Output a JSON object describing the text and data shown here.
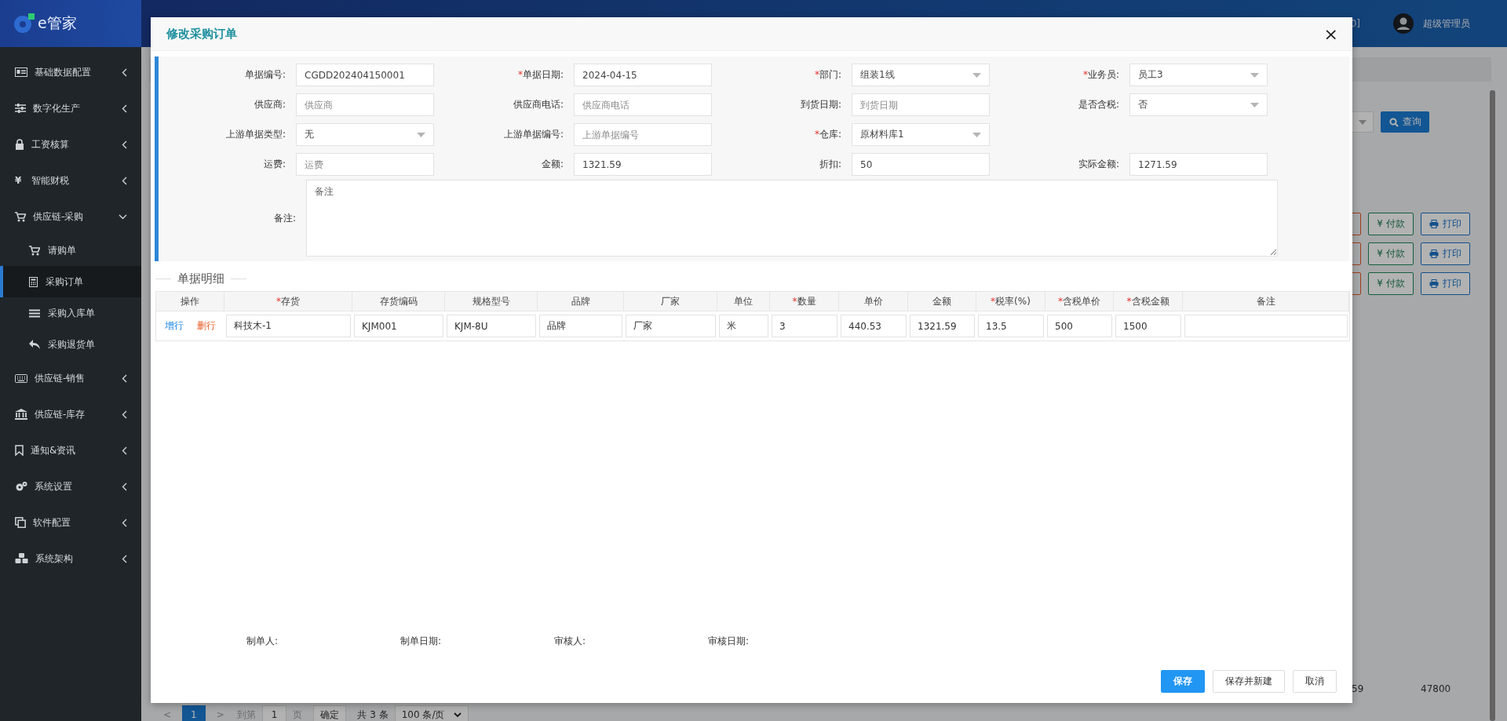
{
  "app": {
    "logo_text": "e管家"
  },
  "sidebar": {
    "items": [
      {
        "label": "基础数据配置",
        "expanded": false
      },
      {
        "label": "数字化生产",
        "expanded": false
      },
      {
        "label": "工资核算",
        "expanded": false
      },
      {
        "label": "智能财税",
        "expanded": false,
        "icon_text": "¥"
      },
      {
        "label": "供应链-采购",
        "expanded": true,
        "children": [
          {
            "label": "请购单",
            "selected": false
          },
          {
            "label": "采购订单",
            "selected": true
          },
          {
            "label": "采购入库单",
            "selected": false
          },
          {
            "label": "采购退货单",
            "selected": false
          }
        ]
      },
      {
        "label": "供应链-销售",
        "expanded": false
      },
      {
        "label": "供应链-库存",
        "expanded": false
      },
      {
        "label": "通知&资讯",
        "expanded": false
      },
      {
        "label": "系统设置",
        "expanded": false
      },
      {
        "label": "软件配置",
        "expanded": false
      },
      {
        "label": "系统架构",
        "expanded": false
      }
    ]
  },
  "header": {
    "partial_text": "0]",
    "user": "超级管理员"
  },
  "background": {
    "search_button": "查询",
    "row_actions": [
      {
        "pay_icon": "¥",
        "pay": "付款",
        "print": "打印"
      },
      {
        "pay_icon": "¥",
        "pay": "付款",
        "print": "打印"
      },
      {
        "pay_icon": "¥",
        "pay": "付款",
        "print": "打印"
      }
    ],
    "row_values": [
      "59",
      "47800"
    ],
    "pagination": {
      "prev": "<",
      "page": "1",
      "next": ">",
      "goto": "到第",
      "page_input": "1",
      "page_unit": "页",
      "confirm": "确定",
      "total": "共 3 条",
      "page_size": "100 条/页"
    }
  },
  "dialog": {
    "title": "修改采购订单",
    "close": "×",
    "required_mark": "*",
    "fields": [
      {
        "label": "单据编号:",
        "required": false,
        "kind": "text",
        "value": "CGDD202404150001"
      },
      {
        "label": "单据日期:",
        "required": true,
        "kind": "text",
        "value": "2024-04-15"
      },
      {
        "label": "部门:",
        "required": true,
        "kind": "select",
        "value": "组装1线"
      },
      {
        "label": "业务员:",
        "required": true,
        "kind": "select",
        "value": "员工3"
      },
      {
        "label": "供应商:",
        "required": false,
        "kind": "text",
        "placeholder": "供应商"
      },
      {
        "label": "供应商电话:",
        "required": false,
        "kind": "text",
        "placeholder": "供应商电话"
      },
      {
        "label": "到货日期:",
        "required": false,
        "kind": "text",
        "placeholder": "到货日期"
      },
      {
        "label": "是否含税:",
        "required": false,
        "kind": "select",
        "value": "否"
      },
      {
        "label": "上游单据类型:",
        "required": false,
        "kind": "select",
        "value": "无"
      },
      {
        "label": "上游单据编号:",
        "required": false,
        "kind": "text",
        "placeholder": "上游单据编号"
      },
      {
        "label": "仓库:",
        "required": true,
        "kind": "select",
        "value": "原材料库1"
      },
      {
        "kind": "empty"
      },
      {
        "label": "运费:",
        "required": false,
        "kind": "text",
        "placeholder": "运费"
      },
      {
        "label": "金额:",
        "required": false,
        "kind": "text",
        "value": "1321.59"
      },
      {
        "label": "折扣:",
        "required": false,
        "kind": "text",
        "value": "50"
      },
      {
        "label": "实际金额:",
        "required": false,
        "kind": "text",
        "value": "1271.59"
      }
    ],
    "remark": {
      "label": "备注:",
      "placeholder": "备注"
    },
    "detail": {
      "title": "单据明细",
      "required_mark": "*",
      "action_column": {
        "label": "操作"
      },
      "columns": [
        {
          "label": "存货",
          "required": true
        },
        {
          "label": "存货编码",
          "required": false
        },
        {
          "label": "规格型号",
          "required": false
        },
        {
          "label": "品牌",
          "required": false
        },
        {
          "label": "厂家",
          "required": false
        },
        {
          "label": "单位",
          "required": false
        },
        {
          "label": "数量",
          "required": true
        },
        {
          "label": "单价",
          "required": false
        },
        {
          "label": "金额",
          "required": false
        },
        {
          "label": "税率(%)",
          "required": true
        },
        {
          "label": "含税单价",
          "required": true
        },
        {
          "label": "含税金额",
          "required": true
        },
        {
          "label": "备注",
          "required": false
        }
      ],
      "rows": [
        {
          "add": "增行",
          "delete": "删行",
          "cells": [
            "科技木-1",
            "KJM001",
            "KJM-8U",
            "品牌",
            "厂家",
            "米",
            "3",
            "440.53",
            "1321.59",
            "13.5",
            "500",
            "1500"
          ]
        }
      ]
    },
    "footer_labels": [
      "制单人:",
      "制单日期:",
      "审核人:",
      "审核日期:"
    ],
    "buttons": [
      {
        "label": "保存",
        "primary": true
      },
      {
        "label": "保存并新建",
        "primary": false
      },
      {
        "label": "取消",
        "primary": false
      }
    ]
  }
}
